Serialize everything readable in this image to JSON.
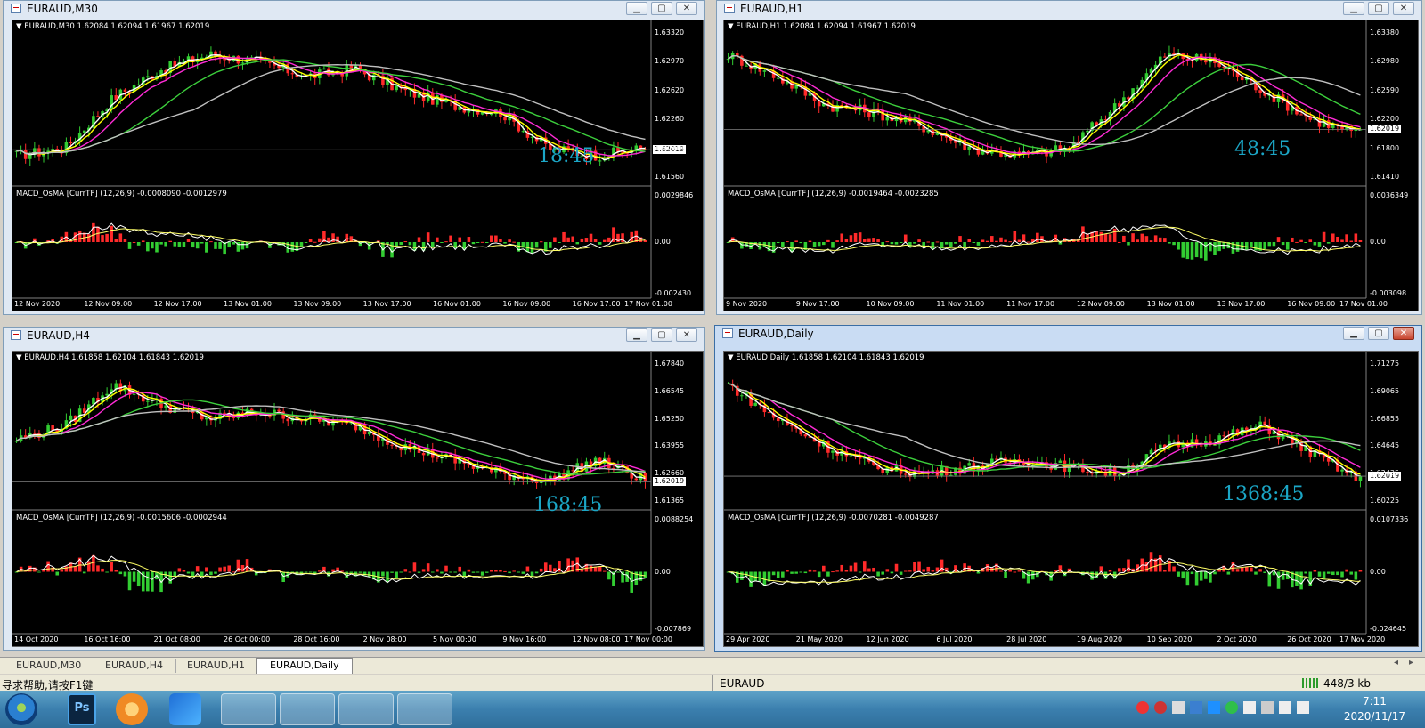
{
  "windows": [
    {
      "id": "m30",
      "title": "EURAUD,M30",
      "header": "EURAUD,M30  1.62084 1.62094 1.61967 1.62019",
      "timer": "18:45",
      "price_ticks": [
        "1.63320",
        "1.62970",
        "1.62620",
        "1.62260",
        "1.61910",
        "1.61560"
      ],
      "current_price": "1.62019",
      "macd_header": "MACD_OsMA [CurrTF] (12,26,9) -0.0008090 -0.0012979",
      "macd_ticks": [
        "0.0029846",
        "0.00",
        "-0.002430"
      ],
      "dates": [
        "12 Nov 2020",
        "12 Nov 09:00",
        "12 Nov 17:00",
        "13 Nov 01:00",
        "13 Nov 09:00",
        "13 Nov 17:00",
        "16 Nov 01:00",
        "16 Nov 09:00",
        "16 Nov 17:00",
        "17 Nov 01:00"
      ]
    },
    {
      "id": "h1",
      "title": "EURAUD,H1",
      "header": "EURAUD,H1  1.62084 1.62094 1.61967 1.62019",
      "timer": "48:45",
      "price_ticks": [
        "1.63380",
        "1.62980",
        "1.62590",
        "1.62200",
        "1.61800",
        "1.61410"
      ],
      "current_price": "1.62019",
      "macd_header": "MACD_OsMA [CurrTF] (12,26,9) -0.0019464 -0.0023285",
      "macd_ticks": [
        "0.0036349",
        "0.00",
        "-0.003098"
      ],
      "dates": [
        "9 Nov 2020",
        "9 Nov 17:00",
        "10 Nov 09:00",
        "11 Nov 01:00",
        "11 Nov 17:00",
        "12 Nov 09:00",
        "13 Nov 01:00",
        "13 Nov 17:00",
        "16 Nov 09:00",
        "17 Nov 01:00"
      ]
    },
    {
      "id": "h4",
      "title": "EURAUD,H4",
      "header": "EURAUD,H4  1.61858 1.62104 1.61843 1.62019",
      "timer": "168:45",
      "price_ticks": [
        "1.67840",
        "1.66545",
        "1.65250",
        "1.63955",
        "1.62660",
        "1.61365"
      ],
      "current_price": "1.62019",
      "macd_header": "MACD_OsMA [CurrTF] (12,26,9) -0.0015606 -0.0002944",
      "macd_ticks": [
        "0.0088254",
        "0.00",
        "-0.007869"
      ],
      "dates": [
        "14 Oct 2020",
        "16 Oct 16:00",
        "21 Oct 08:00",
        "26 Oct 00:00",
        "28 Oct 16:00",
        "2 Nov 08:00",
        "5 Nov 00:00",
        "9 Nov 16:00",
        "12 Nov 08:00",
        "17 Nov 00:00"
      ]
    },
    {
      "id": "d1",
      "title": "EURAUD,Daily",
      "header": "EURAUD,Daily  1.61858 1.62104 1.61843 1.62019",
      "timer": "1368:45",
      "price_ticks": [
        "1.71275",
        "1.69065",
        "1.66855",
        "1.64645",
        "1.62435",
        "1.60225"
      ],
      "current_price": "1.62019",
      "macd_header": "MACD_OsMA [CurrTF] (12,26,9) -0.0070281 -0.0049287",
      "macd_ticks": [
        "0.0107336",
        "0.00",
        "-0.024645"
      ],
      "dates": [
        "29 Apr 2020",
        "21 May 2020",
        "12 Jun 2020",
        "6 Jul 2020",
        "28 Jul 2020",
        "19 Aug 2020",
        "10 Sep 2020",
        "2 Oct 2020",
        "26 Oct 2020",
        "17 Nov 2020"
      ]
    }
  ],
  "tabs": [
    "EURAUD,M30",
    "EURAUD,H4",
    "EURAUD,H1",
    "EURAUD,Daily"
  ],
  "active_tab": "EURAUD,Daily",
  "status": {
    "help": "寻求帮助,请按F1键",
    "symbol": "EURAUD",
    "traffic": "448/3 kb"
  },
  "clock": {
    "time": "7:11",
    "date": "2020/11/17"
  },
  "colors": {
    "bull": "#32cd32",
    "bear": "#ff2a2a",
    "ma_white": "#ffffff",
    "ma_yellow": "#ffff00",
    "ma_magenta": "#ff2bd6",
    "ma_green": "#3ccf3c",
    "ma_gray": "#c0c0c0",
    "timer": "#1ba6c6"
  },
  "taskbar_icons": [
    "start-orb",
    "photoshop-icon",
    "thunder-icon",
    "lanhu-icon",
    "network-icon",
    "explorer-icon",
    "wps-icon",
    "wechat-icon"
  ]
}
